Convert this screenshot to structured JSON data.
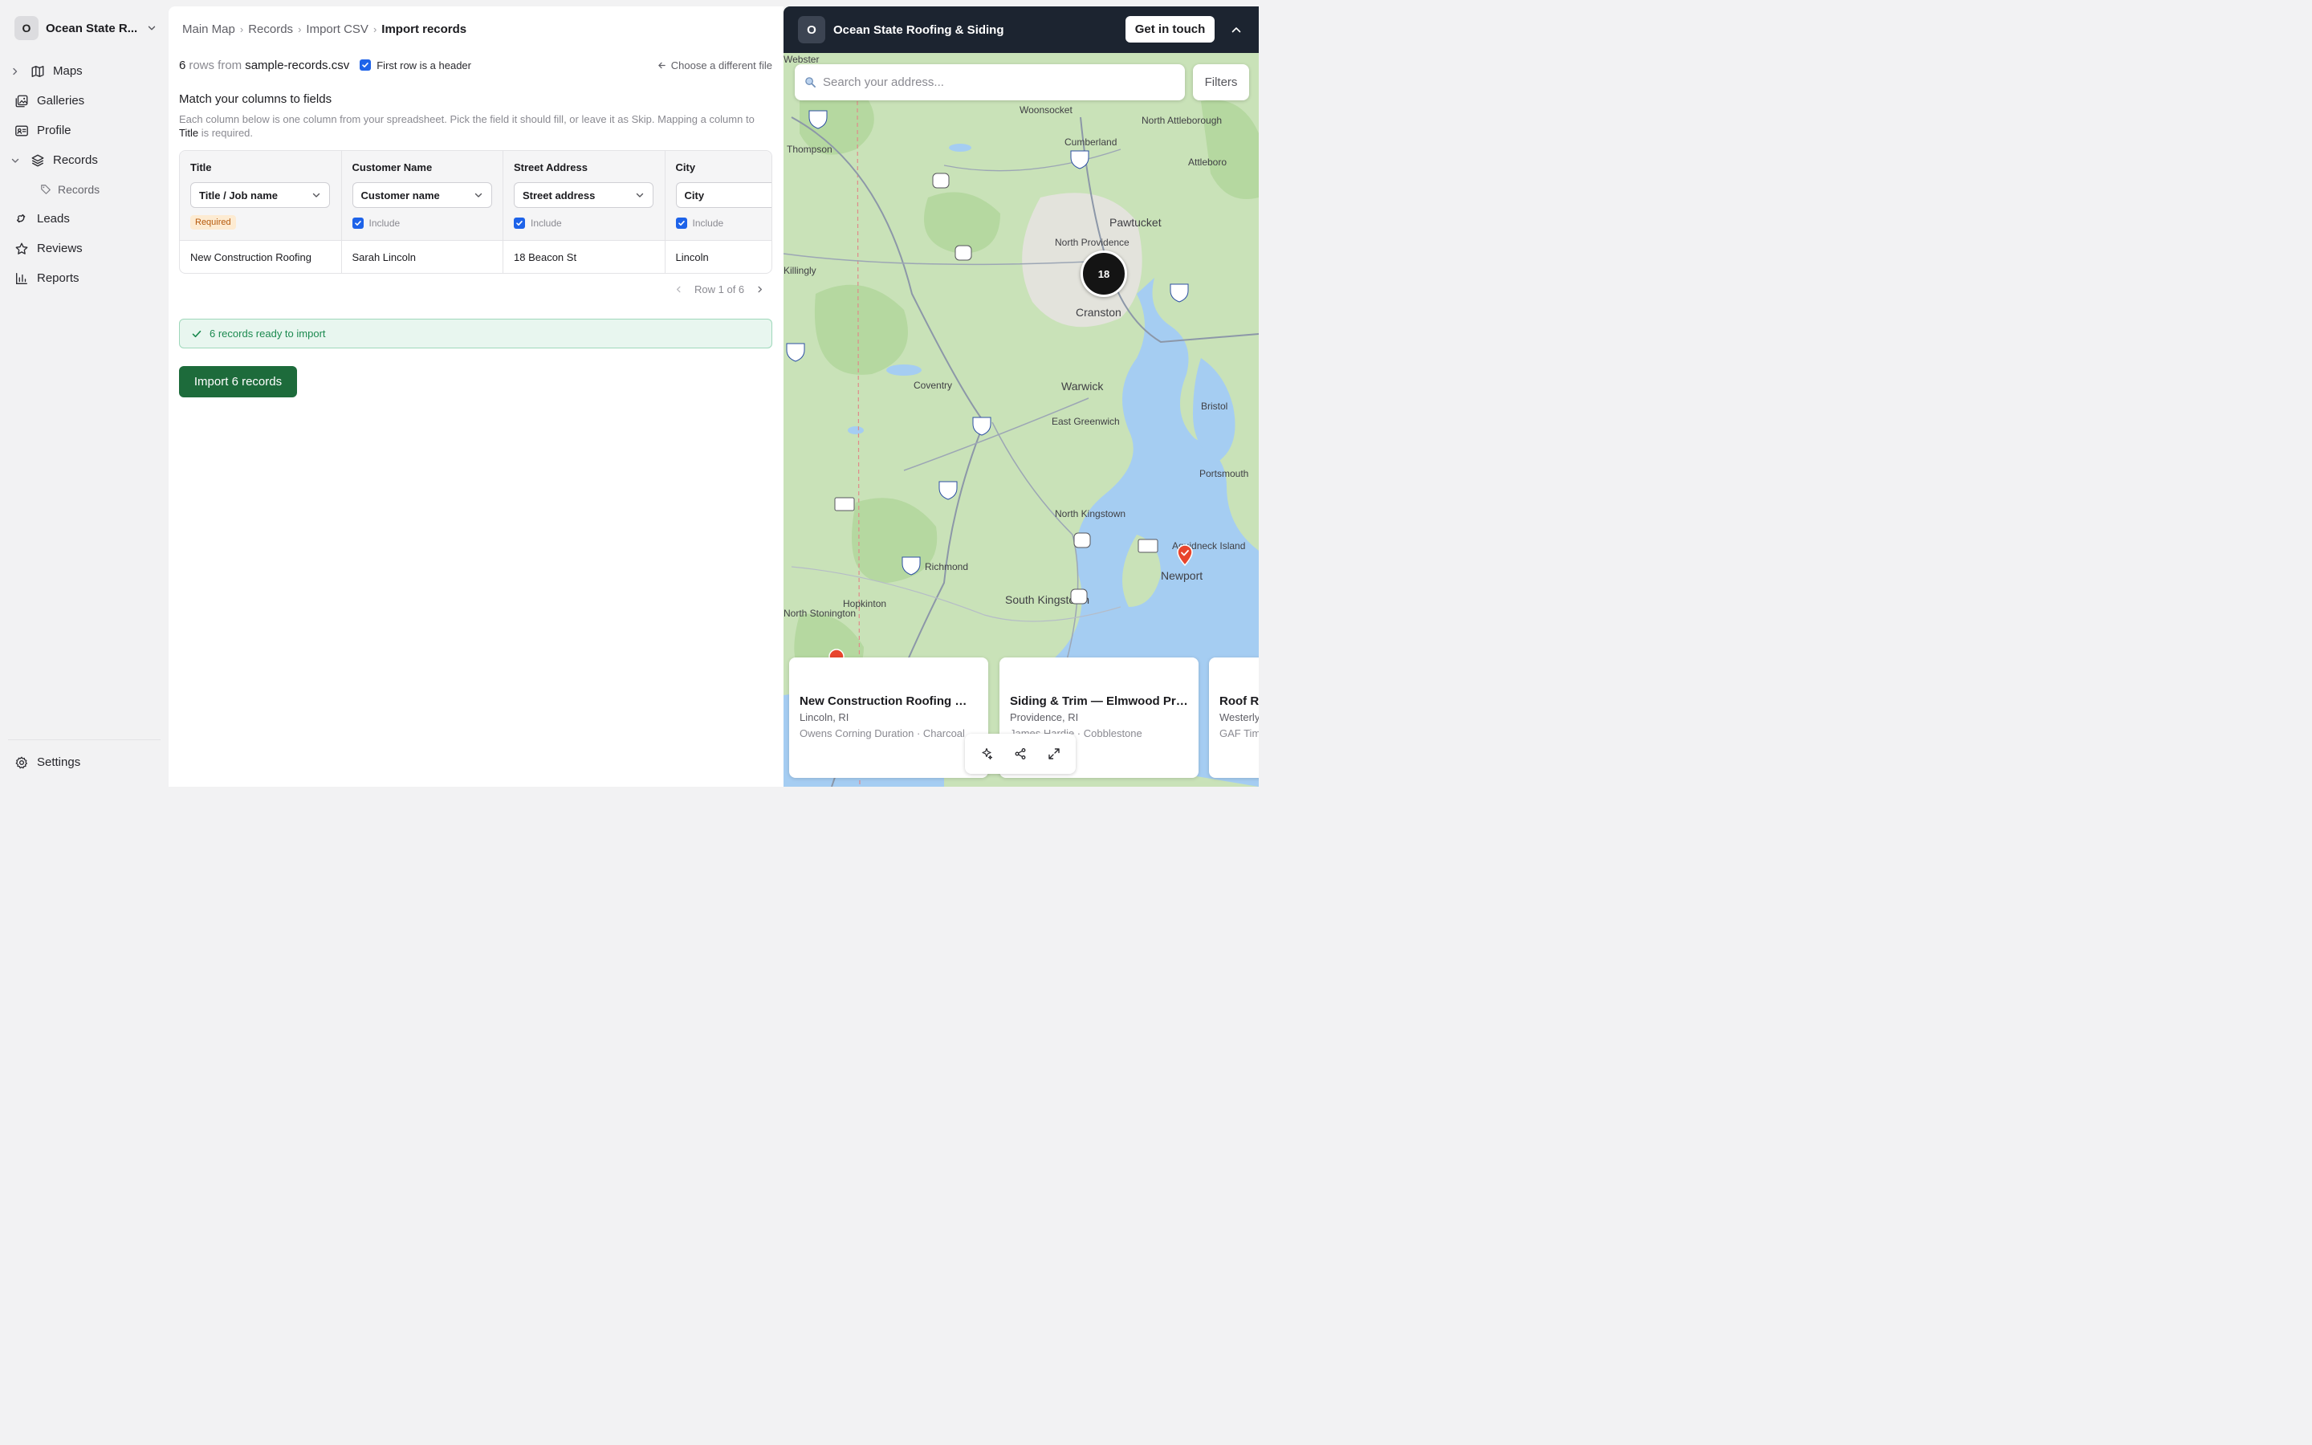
{
  "workspace": {
    "avatar_letter": "O",
    "name": "Ocean State R..."
  },
  "sidebar": {
    "items": [
      {
        "label": "Maps"
      },
      {
        "label": "Galleries"
      },
      {
        "label": "Profile"
      },
      {
        "label": "Records"
      },
      {
        "label": "Records"
      },
      {
        "label": "Leads"
      },
      {
        "label": "Reviews"
      },
      {
        "label": "Reports"
      }
    ],
    "settings_label": "Settings"
  },
  "breadcrumb": [
    "Main Map",
    "Records",
    "Import CSV",
    "Import records"
  ],
  "file_info": {
    "row_count": "6",
    "rows_from": "rows from",
    "file_name": "sample-records.csv",
    "header_checkbox_label": "First row is a header",
    "choose_file_label": "Choose a different file"
  },
  "mapping": {
    "title": "Match your columns to fields",
    "description": "Each column below is one column from your spreadsheet. Pick the field it should fill, or leave it as Skip. Mapping a column to",
    "description_bold": "Title",
    "description_end": "is required.",
    "columns": [
      {
        "header": "Title",
        "field": "Title / Job name",
        "badge": "Required",
        "sample": "New Construction Roofing"
      },
      {
        "header": "Customer Name",
        "field": "Customer name",
        "include": "Include",
        "sample": "Sarah Lincoln"
      },
      {
        "header": "Street Address",
        "field": "Street address",
        "include": "Include",
        "sample": "18 Beacon St"
      },
      {
        "header": "City",
        "field": "City",
        "include": "Include",
        "sample": "Lincoln"
      }
    ],
    "pager_label": "Row 1 of 6"
  },
  "ready_message": "6 records ready to import",
  "import_button": "Import 6 records",
  "widget": {
    "avatar_letter": "O",
    "title": "Ocean State Roofing & Siding",
    "cta": "Get in touch",
    "search_placeholder": "Search your address...",
    "filters_label": "Filters",
    "cluster_count": "18",
    "places": [
      "Webster",
      "Woonsocket",
      "North Attleborough",
      "Cumberland",
      "Attleboro",
      "Thompson",
      "Pawtucket",
      "North Providence",
      "Killingly",
      "Cranston",
      "Coventry",
      "Warwick",
      "Bristol",
      "East Greenwich",
      "Portsmouth",
      "North Kingstown",
      "Aquidneck Island",
      "Newport",
      "Richmond",
      "Hopkinton",
      "South Kingstown",
      "North Stonington"
    ],
    "cards": [
      {
        "title": "New Construction Roofing — ...",
        "location": "Lincoln, RI",
        "material": "Owens Corning Duration · Charcoal"
      },
      {
        "title": "Siding & Trim — Elmwood Pro...",
        "location": "Providence, RI",
        "material": "James Hardie · Cobblestone"
      },
      {
        "title": "Roof Re",
        "location": "Westerly",
        "material": "GAF Tim"
      }
    ]
  },
  "colors": {
    "accent": "#1e63e9",
    "import_green": "#1d6b3b",
    "ready_bg": "#e8f6ef",
    "ready_text": "#1c8a50",
    "required_badge_bg": "#fdebd2",
    "widget_header": "#1c2430",
    "water": "#a5cdf2",
    "land": "#c9e2b8"
  },
  "icons": {
    "sidebar": [
      "map-icon",
      "gallery-icon",
      "profile-icon",
      "layers-icon",
      "tag-icon",
      "magnet-icon",
      "star-icon",
      "bar-chart-icon",
      "gear-icon"
    ],
    "toolbar": [
      "sparkle-icon",
      "share-icon",
      "expand-icon"
    ]
  }
}
